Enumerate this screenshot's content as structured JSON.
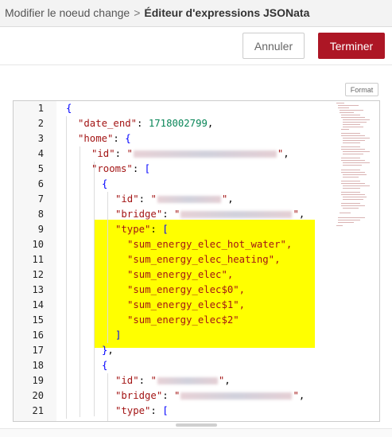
{
  "breadcrumb": {
    "parent": "Modifier le noeud change",
    "separator": ">",
    "current": "Éditeur d'expressions JSONata"
  },
  "toolbar": {
    "cancel_label": "Annuler",
    "done_label": "Terminer"
  },
  "editor": {
    "format_label": "Format",
    "line_numbers": [
      "1",
      "2",
      "3",
      "4",
      "5",
      "6",
      "7",
      "8",
      "9",
      "10",
      "11",
      "12",
      "13",
      "14",
      "15",
      "16",
      "17",
      "18",
      "19",
      "20",
      "21"
    ],
    "date_end_value": "1718002799",
    "type_values": [
      "\"sum_energy_elec_hot_water\",",
      "\"sum_energy_elec_heating\",",
      "\"sum_energy_elec\",",
      "\"sum_energy_elec$0\",",
      "\"sum_energy_elec$1\",",
      "\"sum_energy_elec$2\""
    ]
  },
  "colors": {
    "accent": "#ad1625",
    "highlight": "#ffff00"
  }
}
